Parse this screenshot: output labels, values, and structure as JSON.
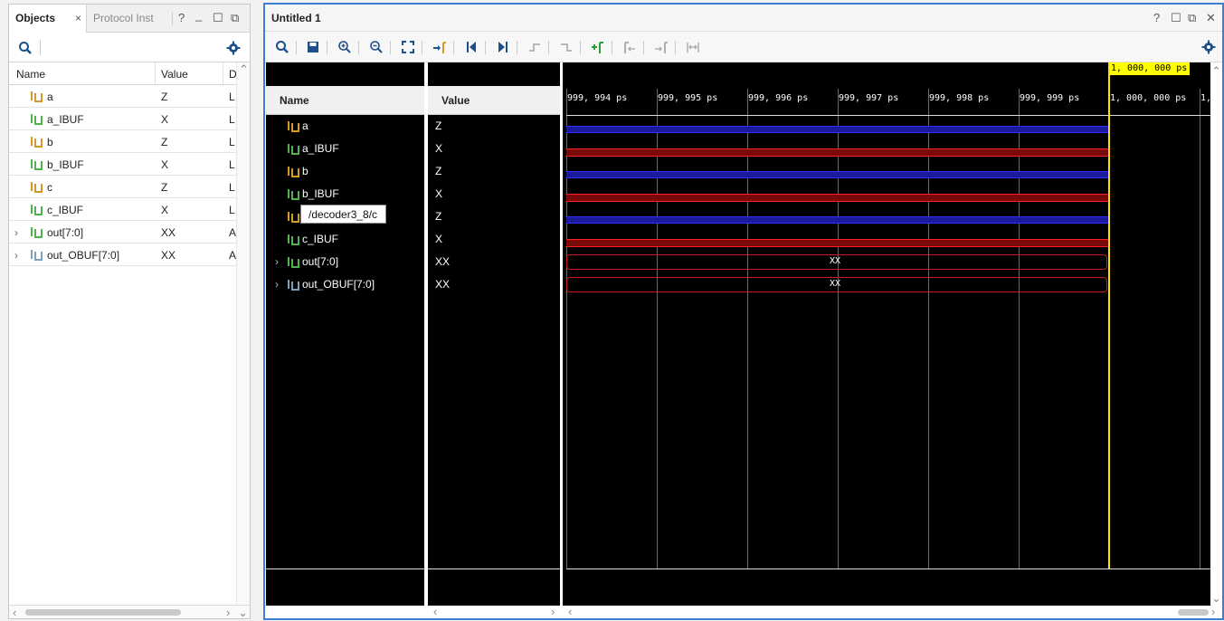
{
  "objects": {
    "tab_active": "Objects",
    "tab_close": "×",
    "tab_inactive": "Protocol Inst",
    "controls": {
      "help": "?",
      "minimize": "_",
      "maximize": "☐",
      "float": "⧉"
    },
    "columns": [
      "Name",
      "Value",
      "D"
    ],
    "rows": [
      {
        "name": "a",
        "value": "Z",
        "d": "L",
        "icon": "input"
      },
      {
        "name": "a_IBUF",
        "value": "X",
        "d": "L",
        "icon": "internal"
      },
      {
        "name": "b",
        "value": "Z",
        "d": "L",
        "icon": "input"
      },
      {
        "name": "b_IBUF",
        "value": "X",
        "d": "L",
        "icon": "internal"
      },
      {
        "name": "c",
        "value": "Z",
        "d": "L",
        "icon": "input"
      },
      {
        "name": "c_IBUF",
        "value": "X",
        "d": "L",
        "icon": "internal"
      },
      {
        "name": "out[7:0]",
        "value": "XX",
        "d": "A",
        "icon": "bus"
      },
      {
        "name": "out_OBUF[7:0]",
        "value": "XX",
        "d": "A",
        "icon": "bus-grey"
      }
    ]
  },
  "wave": {
    "title": "Untitled 1",
    "controls": {
      "help": "?",
      "minimize": "☐",
      "float": "⧉",
      "close": "✕"
    },
    "columns": {
      "name": "Name",
      "value": "Value"
    },
    "cursor_label": "1, 000, 000 ps",
    "tick_labels": [
      "999, 994 ps",
      "999, 995 ps",
      "999, 996 ps",
      "999, 997 ps",
      "999, 998 ps",
      "999, 999 ps",
      "1, 000, 000 ps",
      "1,"
    ],
    "tooltip": "/decoder3_8/c",
    "signals": [
      {
        "name": "a",
        "value": "Z",
        "icon": "input",
        "kind": "z"
      },
      {
        "name": "a_IBUF",
        "value": "X",
        "icon": "internal",
        "kind": "x"
      },
      {
        "name": "b",
        "value": "Z",
        "icon": "input",
        "kind": "z"
      },
      {
        "name": "b_IBUF",
        "value": "X",
        "icon": "internal",
        "kind": "x"
      },
      {
        "name": "c",
        "value": "Z",
        "icon": "input",
        "kind": "z"
      },
      {
        "name": "c_IBUF",
        "value": "X",
        "icon": "internal",
        "kind": "x"
      },
      {
        "name": "out[7:0]",
        "value": "XX",
        "icon": "bus",
        "kind": "bus",
        "bus_text": "XX"
      },
      {
        "name": "out_OBUF[7:0]",
        "value": "XX",
        "icon": "bus-grey",
        "kind": "bus",
        "bus_text": "XX"
      }
    ]
  },
  "colors": {
    "accent_border": "#3c7fd4",
    "z_trace": "#1a1a9a",
    "x_trace": "#7a0a0a",
    "cursor": "#ffe100"
  }
}
